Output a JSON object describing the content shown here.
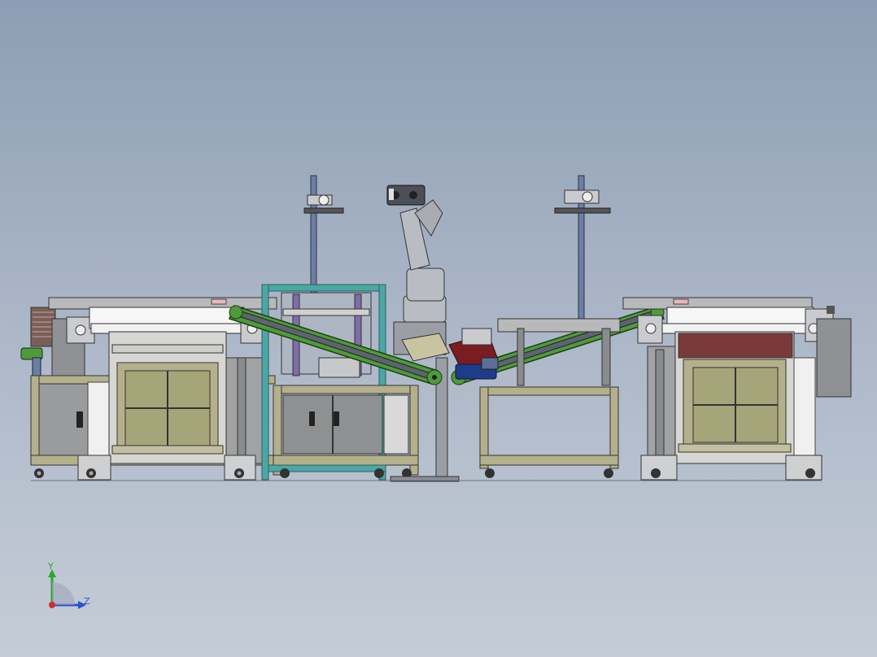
{
  "viewport": {
    "background_top": "#8d9db3",
    "background_bottom": "#c5ccd7"
  },
  "colors": {
    "frame_olive": "#b4b08c",
    "panel_olive": "#a6a57a",
    "cabinet_gray": "#9a9b9d",
    "conveyor_green": "#4f9a3a",
    "conveyor_belt": "#5c6470",
    "robot_gray": "#b9bcc2",
    "pole_blue": "#6a7fa8",
    "teal_frame": "#4aa7a6",
    "bin_red": "#7a1d22",
    "motor_blue": "#1e3c8a",
    "roller_white": "#f4f4f4"
  },
  "triad": {
    "y_label": "Y",
    "z_label": "Z",
    "y_color": "#2fa52f",
    "z_color": "#2b4fd6",
    "x_color": "#d22b2b"
  }
}
